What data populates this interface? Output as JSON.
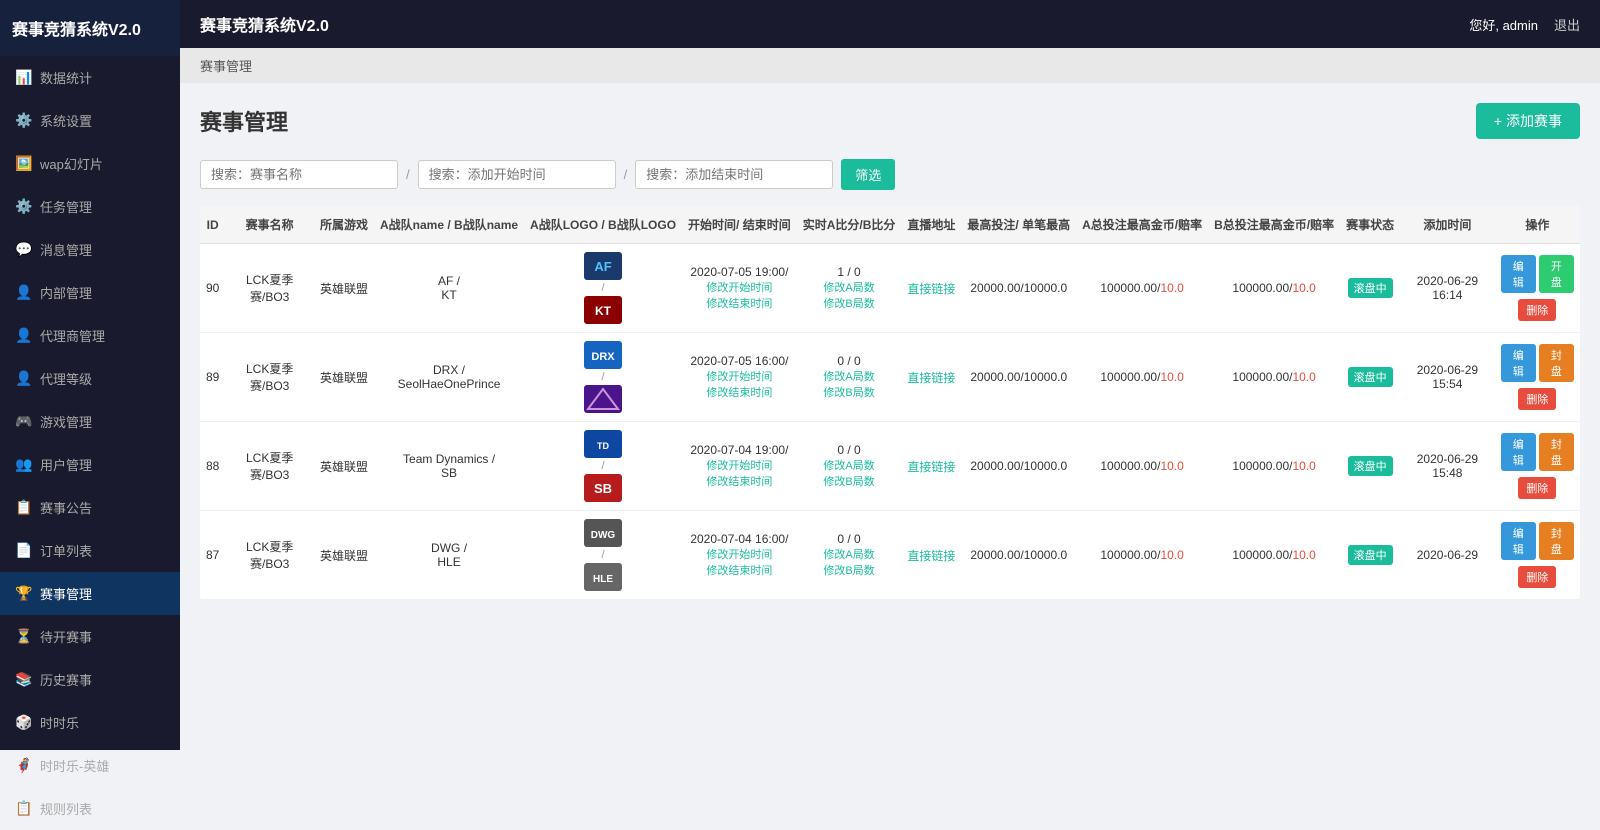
{
  "app": {
    "title": "赛事竞猜系统V2.0",
    "user_greeting": "您好, admin",
    "logout_label": "退出"
  },
  "breadcrumb": "赛事管理",
  "page": {
    "title": "赛事管理",
    "add_button": "+ 添加赛事"
  },
  "search": {
    "name_placeholder": "搜索：赛事名称",
    "start_placeholder": "搜索：添加开始时间",
    "end_placeholder": "搜索：添加结束时间",
    "filter_label": "筛选"
  },
  "sidebar": {
    "items": [
      {
        "label": "数据统计",
        "icon": "📊"
      },
      {
        "label": "系统设置",
        "icon": "⚙️"
      },
      {
        "label": "wap幻灯片",
        "icon": "🖼️"
      },
      {
        "label": "任务管理",
        "icon": "⚙️"
      },
      {
        "label": "消息管理",
        "icon": "💬"
      },
      {
        "label": "内部管理",
        "icon": "👤"
      },
      {
        "label": "代理商管理",
        "icon": "👤"
      },
      {
        "label": "代理等级",
        "icon": "👤"
      },
      {
        "label": "游戏管理",
        "icon": "🎮"
      },
      {
        "label": "用户管理",
        "icon": "👥"
      },
      {
        "label": "赛事公告",
        "icon": "📋"
      },
      {
        "label": "订单列表",
        "icon": "📄"
      },
      {
        "label": "赛事管理",
        "icon": "🏆",
        "active": true
      },
      {
        "label": "待开赛事",
        "icon": "⏳"
      },
      {
        "label": "历史赛事",
        "icon": "📚"
      },
      {
        "label": "时时乐",
        "icon": "🎲"
      },
      {
        "label": "时时乐-英雄",
        "icon": "🦸"
      },
      {
        "label": "规则列表",
        "icon": "📋"
      }
    ]
  },
  "table": {
    "columns": [
      "ID",
      "赛事名称",
      "所属游戏",
      "A战队name / B战队name",
      "A战队LOGO / B战队LOGO",
      "开始时间/ 结束时间",
      "实时A比分/B比分",
      "直播地址",
      "最高投注/ 单笔最高",
      "A总投注最高金币/赔率",
      "B总投注最高金币/赔率",
      "赛事状态",
      "添加时间",
      "操作"
    ],
    "rows": [
      {
        "id": "90",
        "name": "LCK夏季赛/BO3",
        "game": "英雄联盟",
        "team_a": "AF",
        "team_b": "KT",
        "logo_a_color": "#1a6db5",
        "logo_b_color": "#c0392b",
        "start_time": "2020-07-05 19:00/",
        "score": "1 / 0",
        "score_link_a": "修改A局数",
        "score_link_b": "修改B局数",
        "modify_start": "修改开始时间",
        "modify_end": "修改结束时间",
        "live": "直接链接",
        "max_bet": "20000.00/10000.0",
        "a_max": "100000.00/10.0",
        "b_max": "100000.00/10.0",
        "status": "滚盘中",
        "add_time": "2020-06-29 16:14",
        "btn1": "编辑",
        "btn2": "开盘",
        "btn3": "删除"
      },
      {
        "id": "89",
        "name": "LCK夏季赛/BO3",
        "game": "英雄联盟",
        "team_a": "DRX",
        "team_b": "SeolHaeOnePrince",
        "logo_a_color": "#1a6db5",
        "logo_b_color": "#6c3483",
        "start_time": "2020-07-05 16:00/",
        "score": "0 / 0",
        "score_link_a": "修改A局数",
        "score_link_b": "修改B局数",
        "modify_start": "修改开始时间",
        "modify_end": "修改结束时间",
        "live": "直接链接",
        "max_bet": "20000.00/10000.0",
        "a_max": "100000.00/10.0",
        "b_max": "100000.00/10.0",
        "status": "滚盘中",
        "add_time": "2020-06-29 15:54",
        "btn1": "编辑",
        "btn2": "封盘",
        "btn3": "删除"
      },
      {
        "id": "88",
        "name": "LCK夏季赛/BO3",
        "game": "英雄联盟",
        "team_a": "Team Dynamics",
        "team_b": "SB",
        "logo_a_color": "#2980b9",
        "logo_b_color": "#c0392b",
        "start_time": "2020-07-04 19:00/",
        "score": "0 / 0",
        "score_link_a": "修改A局数",
        "score_link_b": "修改B局数",
        "modify_start": "修改开始时间",
        "modify_end": "修改结束时间",
        "live": "直接链接",
        "max_bet": "20000.00/10000.0",
        "a_max": "100000.00/10.0",
        "b_max": "100000.00/10.0",
        "status": "滚盘中",
        "add_time": "2020-06-29 15:48",
        "btn1": "编辑",
        "btn2": "封盘",
        "btn3": "删除"
      },
      {
        "id": "87",
        "name": "LCK夏季赛/BO3",
        "game": "英雄联盟",
        "team_a": "DWG",
        "team_b": "HLE",
        "logo_a_color": "#888",
        "logo_b_color": "#888",
        "start_time": "2020-07-04 16:00/",
        "score": "0 / 0",
        "score_link_a": "修改A局数",
        "score_link_b": "修改B局数",
        "modify_start": "修改开始时间",
        "modify_end": "修改结束时间",
        "live": "直接链接",
        "max_bet": "20000.00/10000.0",
        "a_max": "100000.00/10.0",
        "b_max": "100000.00/10.0",
        "status": "滚盘中",
        "add_time": "2020-06-29",
        "btn1": "编辑",
        "btn2": "封盘",
        "btn3": "删除"
      }
    ]
  }
}
